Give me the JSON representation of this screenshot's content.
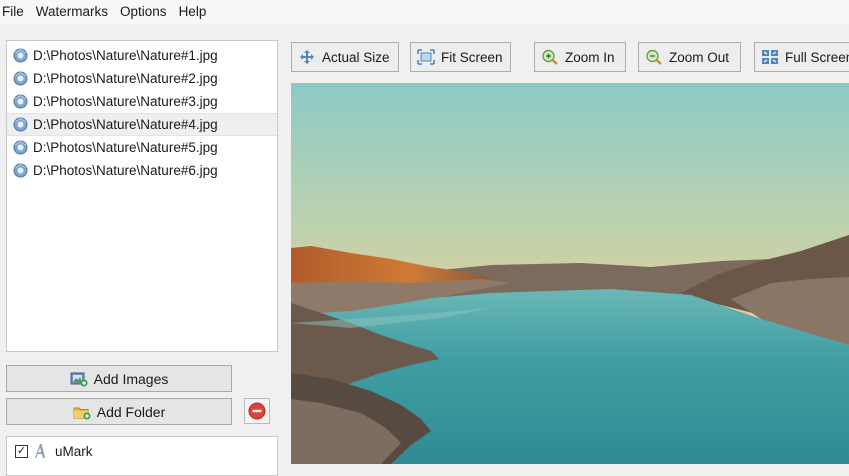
{
  "menu": [
    "File",
    "Watermarks",
    "Options",
    "Help"
  ],
  "files": [
    "D:\\Photos\\Nature\\Nature#1.jpg",
    "D:\\Photos\\Nature\\Nature#2.jpg",
    "D:\\Photos\\Nature\\Nature#3.jpg",
    "D:\\Photos\\Nature\\Nature#4.jpg",
    "D:\\Photos\\Nature\\Nature#5.jpg",
    "D:\\Photos\\Nature\\Nature#6.jpg"
  ],
  "selected_file_index": 3,
  "buttons": {
    "add_images": "Add Images",
    "add_folder": "Add Folder"
  },
  "watermarks": [
    {
      "name": "uMark",
      "checked": true,
      "icon": "text-watermark-icon"
    }
  ],
  "toolbar": {
    "actual_size": "Actual Size",
    "fit_screen": "Fit Screen",
    "zoom_in": "Zoom In",
    "zoom_out": "Zoom Out",
    "full_screen": "Full Screen"
  },
  "icons": {
    "file": "image-file-icon",
    "add_images": "add-images-icon",
    "add_folder": "add-folder-icon",
    "remove": "remove-icon",
    "actual_size": "actual-size-icon",
    "fit_screen": "fit-screen-icon",
    "zoom_in": "zoom-in-icon",
    "zoom_out": "zoom-out-icon",
    "full_screen": "full-screen-icon"
  },
  "colors": {
    "remove_red": "#e0413a",
    "list_selected": "#efefef",
    "water": "#3f9aa2",
    "sky_top": "#8fc9c7",
    "sky_bottom": "#f3c98c"
  }
}
